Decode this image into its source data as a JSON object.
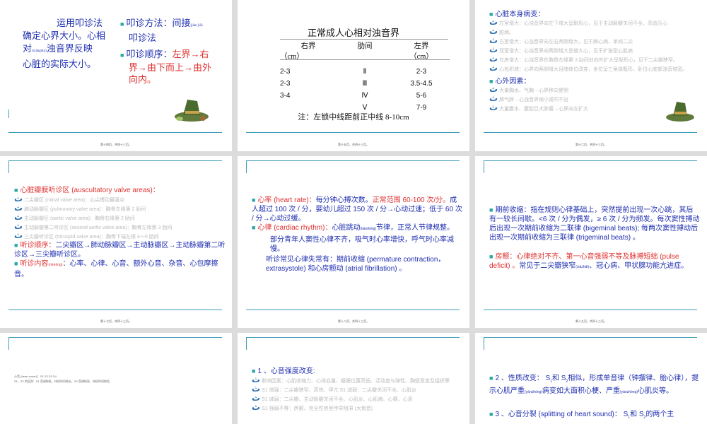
{
  "slide1": {
    "para_line1": "运用叩诊法",
    "para_line2": "确定心界大小。心相",
    "para_line3_a": "对",
    "para_line3_pin": "(xiāngduì)",
    "para_line3_b": "浊音界反映",
    "para_line4": "心脏的实际大小。",
    "b1_a": "叩诊方法：间接",
    "b1_pin": "(jiàn jiē)",
    "b1_b": "叩诊法",
    "b2_label": "叩诊顺序：",
    "b2_red1": "左界→右",
    "b2_red2": "界→由下而上→由外",
    "b2_red3": "向内。",
    "footer": "第十四页，共四十三页。"
  },
  "slide2": {
    "title": "正常成人心相对浊音界",
    "col_right": "右界",
    "col_mid": "肋间",
    "col_left": "左界",
    "unit": "（cm）",
    "rows": [
      {
        "r": "2-3",
        "m": "Ⅱ",
        "l": "2-3"
      },
      {
        "r": "2-3",
        "m": "Ⅲ",
        "l": "3.5-4.5"
      },
      {
        "r": "3-4",
        "m": "Ⅳ",
        "l": "5-6"
      },
      {
        "r": "",
        "m": "Ⅴ",
        "l": "7-9"
      }
    ],
    "note": "注：左锁中线距前正中线 8-10cm",
    "footer": "第十五页，共四十三页。"
  },
  "slide3": {
    "h1": "心脏本身病变：",
    "faint_lines": [
      "左室增大：心浊音界向左下增大呈靴形心，见于主动脉瓣关闭不全、高血压心",
      "脏病。",
      "右室增大：心浊音界向左右两侧增大，见于肺心病、单纯二尖",
      "双室增大：心浊音界向两侧增大呈普大心，见于扩张型心肌病",
      "左房增大：心浊音界在胸骨左缘第 3 肋间处向外扩大呈梨形心，见于二尖瓣狭窄。",
      "心包积液：心界向两侧增大且随体位改变，坐位呈三角烧瓶形，卧位心底部浊音增宽。"
    ],
    "h2": "心外因素：",
    "faint2": [
      "大量胸水、气胸→心界移向健侧",
      "肺气肿→心浊音界缩小或叩不出",
      "大量腹水、腹腔巨大肿瘤→心界向左扩大"
    ],
    "footer": "第十六页，共四十三页。"
  },
  "slide4": {
    "title_red": "心脏瓣膜听诊区 (auscultatory valve areas)：",
    "faint": [
      "二尖瓣区 (mitral valve area)：心尖搏动最强点",
      "肺动脉瓣区 (pulmonary valve area)：胸骨左缘第 2 肋间",
      "主动脉瓣区 (aortic valve area)：胸骨右缘第 2 肋间",
      "主动脉瓣第二听诊区 (second aortic valve area)：胸骨左缘第 3 肋间",
      "三尖瓣听诊区 (tricuspid valve area)：胸骨下端左缘 4～5 肋间"
    ],
    "order_red": "听诊顺序：",
    "order_text": "二尖瓣区→肺动脉瓣区→主动脉瓣区→主动脉瓣第二听诊区→三尖瓣听诊区。",
    "content_red": "听诊内容",
    "content_pin": "(nèiróng)",
    "content_text": "：心率、心律、心音、额外心音、杂音、心包摩擦音。",
    "footer": "第十七页，共四十三页。"
  },
  "slide5": {
    "hr_red": "心率 (heart rate)：",
    "hr_text": "每分钟心搏次数。",
    "hr_red2": "正常范围 60-100 次/分。",
    "hr_text2": "成人超过 100 次 / 分，婴幼儿超过 150 次 / 分→心动过速；低于 60 次 / 分→心动过缓。",
    "rhythm_red": "心律 (cardiac rhythm)：",
    "rhythm_text_a": "心脏跳动",
    "rhythm_pin": "(tiàodòng)",
    "rhythm_text_b": "节律，正常人节律规整。",
    "para1": "部分青年人窦性心律不齐，吸气时心率增快，呼气时心率减慢。",
    "para2": "听诊常见心律失常有：期前收缩 (permature contraction， extrasystole) 和心房颤动 (atrial fibrillation) 。",
    "footer": "第十八页，共四十三页。"
  },
  "slide6": {
    "p1": "期前收缩：指在规则心律基础上，突然提前出现一次心跳，其后有一较长间歇。<6 次 / 分为偶发，≥ 6 次 / 分为频发。每次窦性搏动后出现一次期前收缩为二联律 (bigeminal beats); 每两次窦性搏动后出现一次期前收缩为三联律 (trigeminal beats) 。",
    "p2_red": "房颤：心律绝对不齐、第一心音强弱不等及脉搏短绌 (pulse deficit) 。",
    "p2_a": "常见于二尖瓣狭窄",
    "p2_pin": "(xiázhǎi)",
    "p2_b": "、冠心病、甲状腺功能亢进症。",
    "footer": "第十九页，共四十三页。"
  },
  "slide7": {
    "tiny1": "心音 (heart sound)：S1 S2 S3 S4",
    "tiny2": "S1、S2 的区别：S1 音调较低、持续时间较长，S2 音调较高、持续时间较短"
  },
  "slide8": {
    "h": "1 、心音强度改变:",
    "faint": [
      "影响因素：心肌收缩力、心排血量、瓣膜位置高低、活动度与弹性、胸壁厚度及组织等",
      "S1 增强：二尖瓣狭窄、高热、甲亢 S1 减弱：二尖瓣关闭不全、心肌炎",
      "S1 减弱：二尖瓣、主动脉瓣关闭不全、心肌炎、心肌病、心梗、心衰",
      "S1 强弱不等：房颤、完全性房室传导阻滞 (大炮音)"
    ]
  },
  "slide9": {
    "p1_a": "2 、性质改变： S",
    "p1_b": "和 S",
    "p1_c": "相似，形成单音律（钟摆律、胎心律），提示心肌严重",
    "p1_pin": "(yánzhòng)",
    "p1_d": "病变如大面积心梗、严重",
    "p1_pin2": "(yánzhòng)",
    "p1_e": "心肌炎等。",
    "sub1": "1",
    "sub2": "2",
    "p2": "3 、心音分裂 (splitting of heart sound)： S",
    "p2_b": "和 S",
    "p2_c": "的两个主"
  }
}
